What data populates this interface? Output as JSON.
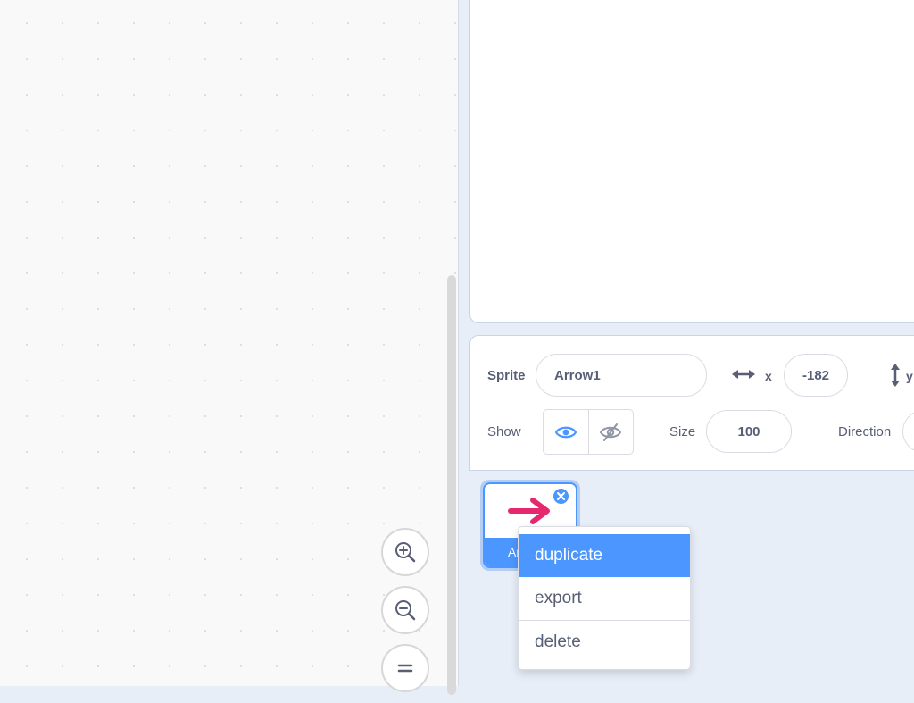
{
  "sprite_info": {
    "sprite_label": "Sprite",
    "sprite_name": "Arrow1",
    "x_label": "x",
    "x_value": "-182",
    "y_label": "y",
    "show_label": "Show",
    "size_label": "Size",
    "size_value": "100",
    "direction_label": "Direction"
  },
  "sprite_tile": {
    "name_visible": "Ar",
    "arrow_color": "#e6286e"
  },
  "context_menu": {
    "items": [
      {
        "label": "duplicate",
        "active": true
      },
      {
        "label": "export",
        "active": false
      },
      {
        "label": "delete",
        "active": false
      }
    ]
  },
  "colors": {
    "accent": "#4c97ff",
    "text": "#575e75"
  },
  "icons": {
    "zoom_in": "zoom-in-icon",
    "zoom_out": "zoom-out-icon",
    "zoom_reset": "zoom-reset-icon",
    "show": "eye-icon",
    "hide": "eye-slash-icon",
    "x_axis": "horizontal-arrows-icon",
    "y_axis": "vertical-arrows-icon",
    "delete_sprite": "close-icon"
  }
}
